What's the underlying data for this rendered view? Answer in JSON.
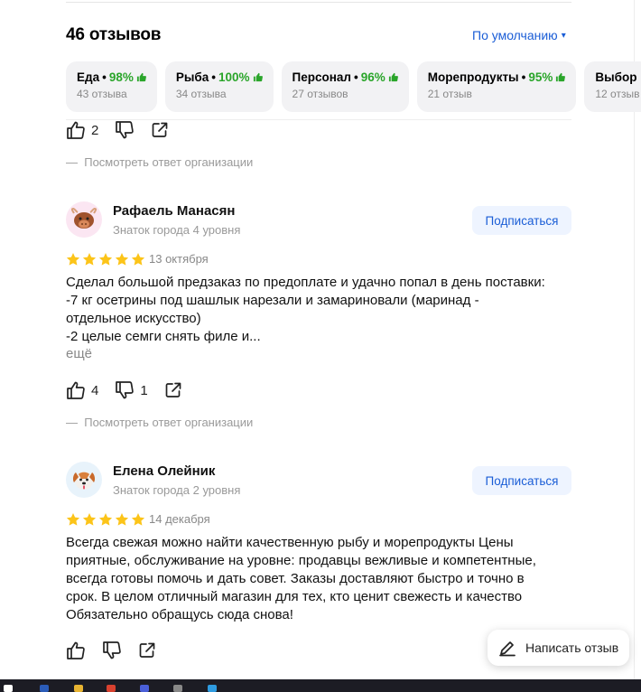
{
  "header": {
    "title": "46 отзывов",
    "sort_label": "По умолчанию",
    "sort_caret": "▾"
  },
  "chips": [
    {
      "name": "Еда",
      "pct": "98%",
      "count": "43 отзыва"
    },
    {
      "name": "Рыба",
      "pct": "100%",
      "count": "34 отзыва"
    },
    {
      "name": "Персонал",
      "pct": "96%",
      "count": "27 отзывов"
    },
    {
      "name": "Морепродукты",
      "pct": "95%",
      "count": "21 отзыв"
    },
    {
      "name": "Выбор",
      "pct": "",
      "count": "12 отзыв"
    }
  ],
  "prev_review": {
    "likes": "2",
    "org_reply": "Посмотреть ответ организации"
  },
  "reviews": [
    {
      "author": "Рафаель Манасян",
      "level": "Знаток города 4 уровня",
      "subscribe": "Подписаться",
      "rating": 5,
      "date": "13 октября",
      "text_lines": [
        "Сделал большой предзаказ по предоплате и удачно попал в день поставки:",
        "-7 кг осетрины под шашлык нарезали и замариновали (маринад -",
        "отдельное искусство)",
        "-2 целые семги снять филе и..."
      ],
      "more": "ещё",
      "likes": "4",
      "dislikes": "1",
      "org_reply": "Посмотреть ответ организации"
    },
    {
      "author": "Елена Олейник",
      "level": "Знаток города 2 уровня",
      "subscribe": "Подписаться",
      "rating": 5,
      "date": "14 декабря",
      "text_lines": [
        "Всегда свежая можно найти качественную рыбу и морепродукты Цены",
        "приятные, обслуживание на уровне: продавцы вежливые и компетентные,",
        "всегда готовы помочь и дать совет. Заказы доставляют быстро и точно в",
        "срок. В целом отличный магазин для тех, кто ценит свежесть и качество",
        "Обязательно обращусь сюда снова!"
      ]
    }
  ],
  "write_review": "Написать отзыв",
  "colors": {
    "accent": "#1a5dd6",
    "positive": "#2aa52a",
    "star": "#fcc419"
  }
}
